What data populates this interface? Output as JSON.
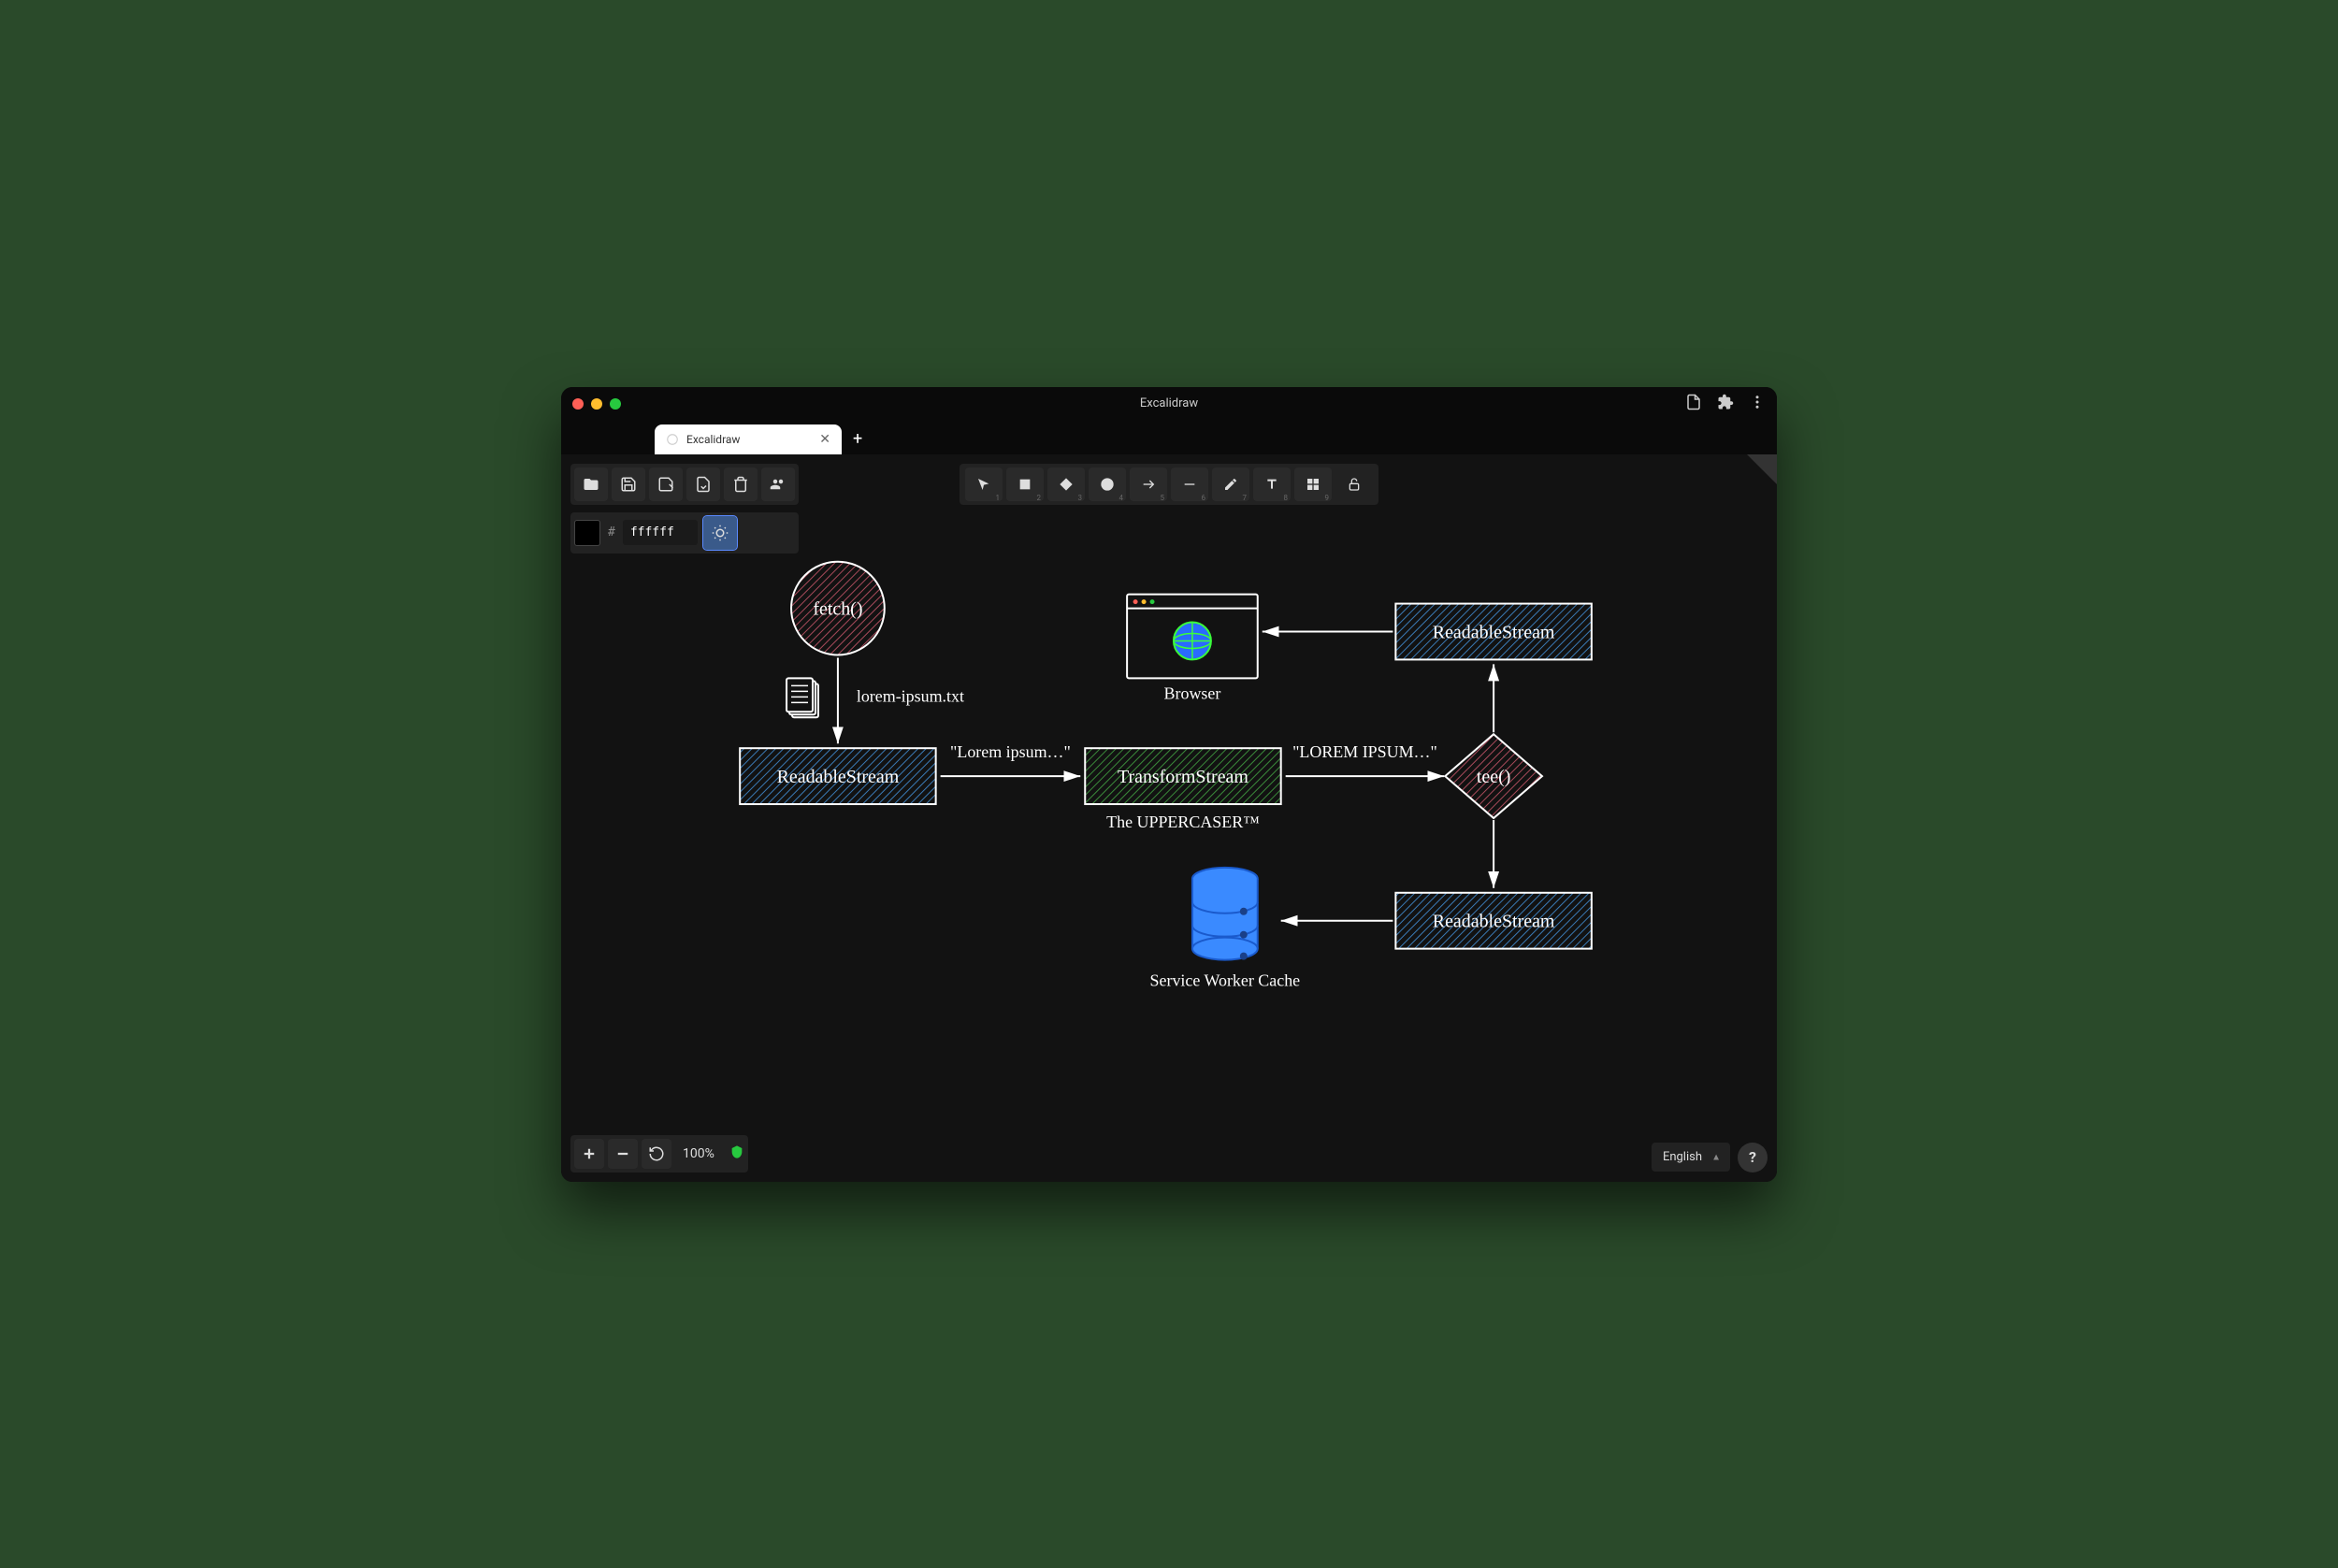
{
  "window": {
    "title": "Excalidraw",
    "tab_label": "Excalidraw"
  },
  "toolbar_top": {
    "tools": [
      {
        "name": "selection",
        "key": "1"
      },
      {
        "name": "rectangle",
        "key": "2"
      },
      {
        "name": "diamond",
        "key": "3"
      },
      {
        "name": "ellipse",
        "key": "4"
      },
      {
        "name": "arrow",
        "key": "5"
      },
      {
        "name": "line",
        "key": "6"
      },
      {
        "name": "draw",
        "key": "7"
      },
      {
        "name": "text",
        "key": "8"
      },
      {
        "name": "image",
        "key": "9"
      }
    ]
  },
  "color": {
    "hash": "#",
    "value": "ffffff"
  },
  "zoom": {
    "level": "100%"
  },
  "language": {
    "selected": "English"
  },
  "diagram": {
    "nodes": {
      "fetch": "fetch()",
      "file_label": "lorem-ipsum.txt",
      "readable1": "ReadableStream",
      "arrow1_label": "\"Lorem ipsum…\"",
      "transform": "TransformStream",
      "transform_caption": "The UPPERCASER™",
      "arrow2_label": "\"LOREM IPSUM…\"",
      "tee": "tee()",
      "readable2": "ReadableStream",
      "readable3": "ReadableStream",
      "browser": "Browser",
      "cache": "Service Worker Cache"
    }
  }
}
